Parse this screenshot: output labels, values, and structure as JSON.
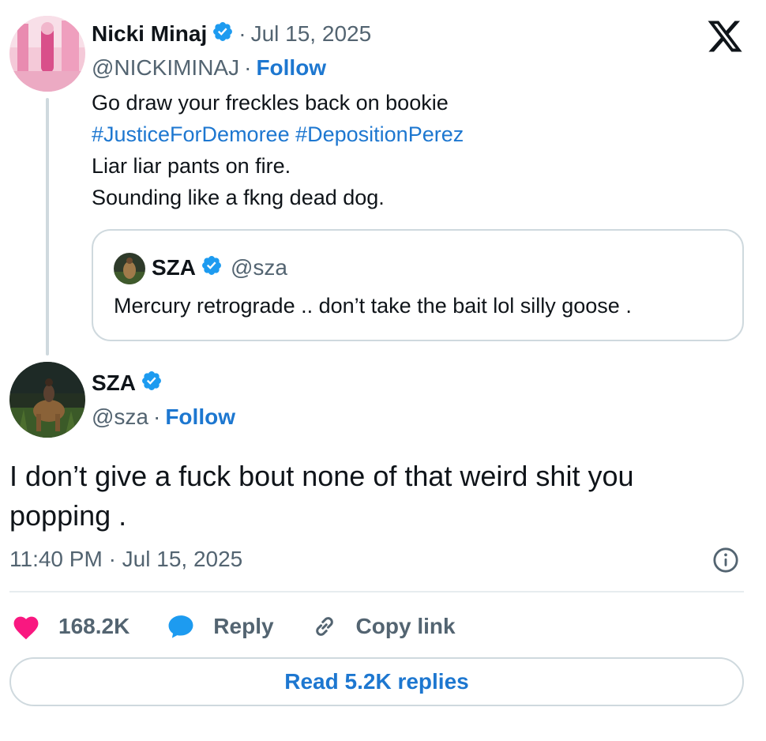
{
  "parent": {
    "name": "Nicki Minaj",
    "date": "Jul 15, 2025",
    "handle": "@NICKIMINAJ",
    "follow": "Follow",
    "text_lines": [
      "Go draw your freckles back on bookie",
      "#JusticeForDemoree #DepositionPerez",
      "Liar liar pants on fire.",
      "Sounding like a fkng dead dog."
    ],
    "hashtags": [
      "#JusticeForDemoree",
      "#DepositionPerez"
    ]
  },
  "quote": {
    "name": "SZA",
    "handle": "@sza",
    "text": "Mercury retrograde .. don’t take the bait lol silly goose ."
  },
  "main": {
    "name": "SZA",
    "handle": "@sza",
    "follow": "Follow",
    "text": "I don’t give a fuck bout none of that weird shit you popping .",
    "time": "11:40 PM",
    "date": "Jul 15, 2025"
  },
  "actions": {
    "likes": "168.2K",
    "reply": "Reply",
    "copy_link": "Copy link"
  },
  "read_replies": "Read 5.2K replies",
  "icons": {
    "logo": "x-logo-icon",
    "verified": "verified-badge-icon",
    "info": "info-icon",
    "like": "heart-icon",
    "reply": "speech-bubble-icon",
    "copy": "link-icon"
  },
  "colors": {
    "link_blue": "#1d77d0",
    "verified_blue": "#1d9bf0",
    "like_pink": "#f91880",
    "muted": "#536471",
    "border": "#cfd9de"
  }
}
